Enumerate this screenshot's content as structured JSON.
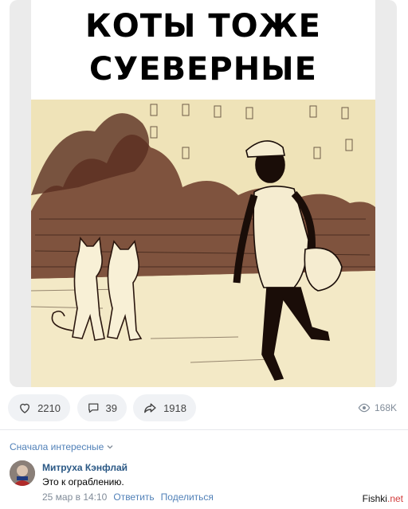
{
  "meme": {
    "caption_line1": "КОТЫ ТОЖЕ",
    "caption_line2": "СУЕВЕРНЫЕ"
  },
  "actions": {
    "likes": "2210",
    "comments": "39",
    "shares": "1918",
    "views": "168K"
  },
  "sort": {
    "label": "Сначала интересные"
  },
  "comment": {
    "author": "Митруха Кэнфлай",
    "text": "Это к ограблению.",
    "date": "25 мар в 14:10",
    "reply_label": "Ответить",
    "share_label": "Поделиться"
  },
  "watermark": {
    "brand": "Fishki",
    "suffix": ".net"
  },
  "colors": {
    "link": "#2a5885",
    "accent": "#5181b8",
    "muted": "#818c99",
    "pill_bg": "#f0f2f5",
    "cartoon_bg": "#efe3b8"
  }
}
